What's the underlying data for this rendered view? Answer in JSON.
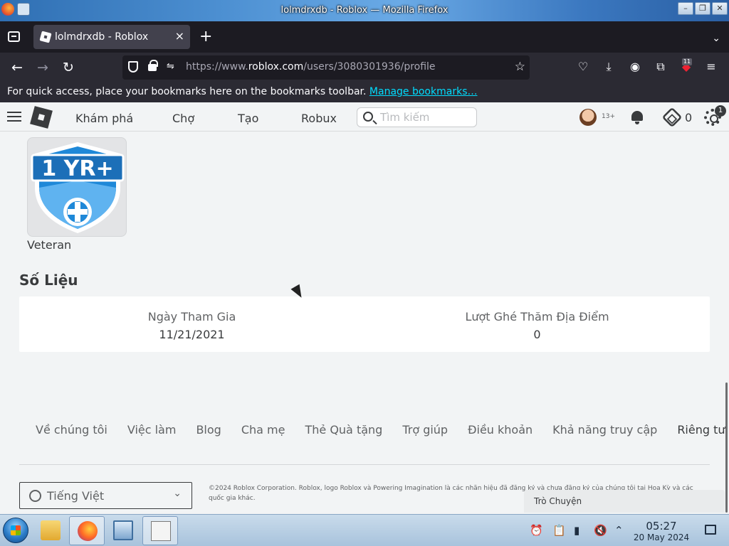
{
  "window": {
    "title": "lolmdrxdb - Roblox — Mozilla Firefox"
  },
  "browser": {
    "tab_title": "lolmdrxdb - Roblox",
    "url_prefix": "https://www.",
    "url_host": "roblox.com",
    "url_path": "/users/3080301936/profile",
    "extension_badge": "11",
    "bookmarks_prompt": "For quick access, place your bookmarks here on the bookmarks toolbar.",
    "bookmarks_link": "Manage bookmarks…"
  },
  "header": {
    "nav": [
      "Khám phá",
      "Chợ",
      "Tạo",
      "Robux"
    ],
    "search_placeholder": "Tìm kiếm",
    "age_badge": "13+",
    "robux_balance": "0",
    "settings_badge": "1"
  },
  "badge": {
    "name": "Veteran",
    "emblem_text": "1 YR+"
  },
  "stats": {
    "title": "Số Liệu",
    "items": [
      {
        "label": "Ngày Tham Gia",
        "value": "11/21/2021"
      },
      {
        "label": "Lượt Ghé Thăm Địa Điểm",
        "value": "0"
      }
    ]
  },
  "footer": {
    "links": [
      "Về chúng tôi",
      "Việc làm",
      "Blog",
      "Cha mẹ",
      "Thẻ Quà tặng",
      "Trợ giúp",
      "Điều khoản",
      "Khả năng truy cập",
      "Riêng tư"
    ],
    "language": "Tiếng Việt",
    "copyright": "©2024 Roblox Corporation. Roblox, logo Roblox và Powering Imagination là các nhãn hiệu đã đăng ký và chưa đăng ký của chúng tôi tại Hoa Kỳ và các quốc gia khác."
  },
  "chat": {
    "label": "Trò Chuyện"
  },
  "taskbar": {
    "time": "05:27",
    "date": "20 May 2024"
  },
  "colors": {
    "page_bg": "#f2f4f5",
    "text": "#393b3d",
    "badge_blue": "#1e88d8",
    "link_cyan": "#00ddff"
  }
}
